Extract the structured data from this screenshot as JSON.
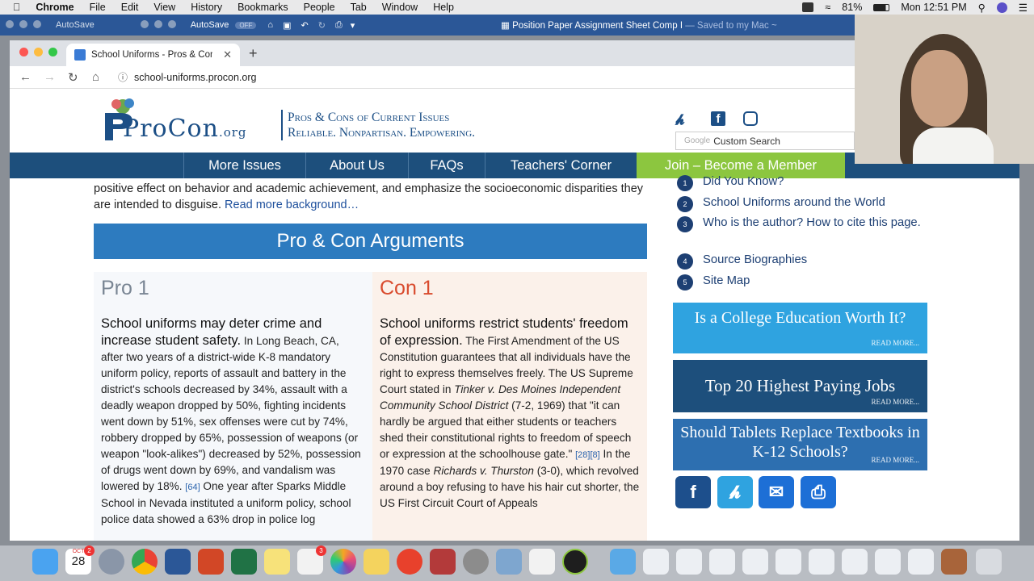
{
  "menubar": {
    "items": [
      "Chrome",
      "File",
      "Edit",
      "View",
      "History",
      "Bookmarks",
      "People",
      "Tab",
      "Window",
      "Help"
    ],
    "battery": "81%",
    "clock": "Mon 12:51 PM"
  },
  "word": {
    "autosave_left": "AutoSave",
    "autosave_right": "AutoSave",
    "toggle": "OFF",
    "doc_title": "Position Paper Assignment Sheet Comp I",
    "doc_status": " — Saved to my Mac ~"
  },
  "browser": {
    "tab_title": "School Uniforms - Pros & Cons",
    "url": "school-uniforms.procon.org"
  },
  "site": {
    "logo": "ProCon",
    "logo_suffix": ".org",
    "tagline_1": "Pros & Cons of Current Issues",
    "tagline_2": "Reliable. Nonpartisan. Empowering.",
    "search_brand": "Google",
    "search_placeholder": "Custom Search",
    "nav": [
      "More Issues",
      "About Us",
      "FAQs",
      "Teachers' Corner",
      "Join – Become a Member"
    ]
  },
  "main": {
    "background_text": "positive effect on behavior and academic achievement, and emphasize the socioeconomic disparities they are intended to disguise.",
    "read_more": "Read more background…",
    "section_title": "Pro & Con Arguments",
    "pro": {
      "heading": "Pro 1",
      "lead": "School uniforms may deter crime and increase student safety.",
      "body": "In Long Beach, CA, after two years of a district-wide K-8 mandatory uniform policy, reports of assault and battery in the district's schools decreased by 34%, assault with a deadly weapon dropped by 50%, fighting incidents went down by 51%, sex offenses were cut by 74%, robbery dropped by 65%, possession of weapons (or weapon \"look-alikes\") decreased by 52%, possession of drugs went down by 69%, and vandalism was lowered by 18%.",
      "cite1": "[64]",
      "body2": "One year after Sparks Middle School in Nevada instituted a uniform policy, school police data showed a 63% drop in police log"
    },
    "con": {
      "heading": "Con 1",
      "lead": "School uniforms restrict students' freedom of expression.",
      "body1": "The First Amendment of the US Constitution guarantees that all individuals have the right to express themselves freely. The US Supreme Court stated in",
      "case1": "Tinker v. Des Moines Independent Community School District",
      "body2": "(7-2, 1969) that \"it can hardly be argued that either students or teachers shed their constitutional rights to freedom of speech or expression at the schoolhouse gate.\"",
      "cite1": "[28][8]",
      "body3": "In the 1970 case",
      "case2": "Richards v. Thurston",
      "body4": "(3-0), which revolved around a boy refusing to have his hair cut shorter, the US First Circuit Court of Appeals"
    }
  },
  "sidebar": {
    "items": [
      {
        "num": "1",
        "label": "Did You Know?"
      },
      {
        "num": "2",
        "label": "School Uniforms around the World"
      },
      {
        "num": "3",
        "label": "Who is the author? How to cite this page."
      },
      {
        "num": "4",
        "label": "Source Biographies"
      },
      {
        "num": "5",
        "label": "Site Map"
      }
    ],
    "promos": [
      {
        "title": "Is a College Education Worth It?",
        "more": "READ MORE...",
        "color": "#2fa3e0"
      },
      {
        "title": "Top 20 Highest Paying Jobs",
        "more": "READ MORE...",
        "color": "#1d4f7c"
      },
      {
        "title": "Should Tablets Replace Textbooks in K-12 Schools?",
        "more": "READ MORE...",
        "color": "#2d6fb0"
      }
    ]
  },
  "dock": {
    "calendar_month": "OCT",
    "calendar_day": "28",
    "calendar_badge": "2",
    "reminder_badge": "3"
  }
}
